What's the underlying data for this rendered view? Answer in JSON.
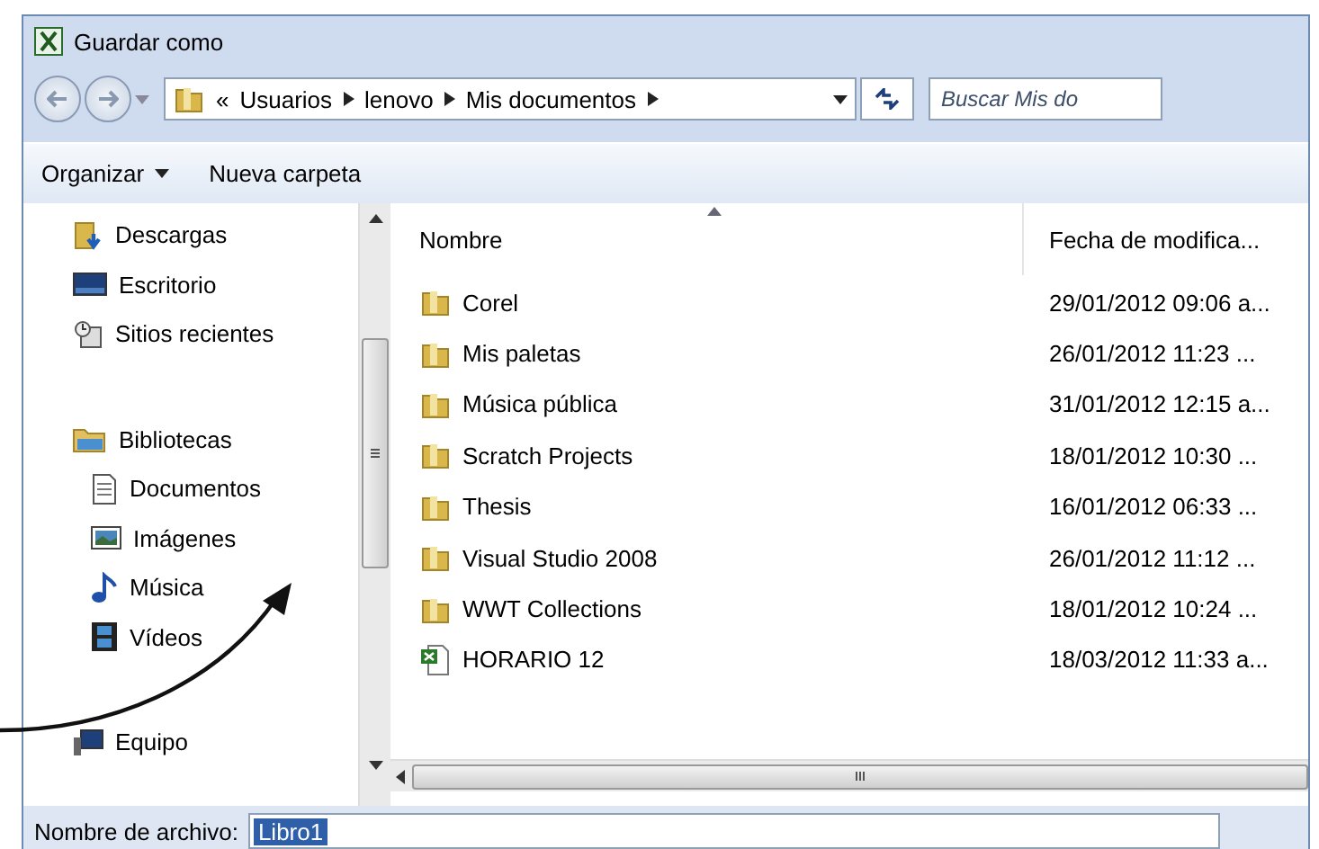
{
  "window": {
    "title": "Guardar como"
  },
  "address_bar": {
    "crumbs": [
      "«",
      "Usuarios",
      "lenovo",
      "Mis documentos"
    ],
    "search_placeholder": "Buscar Mis do"
  },
  "toolbar": {
    "buttons": [
      {
        "label": "Organizar",
        "dropdown": true
      },
      {
        "label": "Nueva carpeta",
        "dropdown": false
      }
    ]
  },
  "sidebar": {
    "groups": [
      {
        "items": [
          {
            "label": "Descargas"
          },
          {
            "label": "Escritorio"
          },
          {
            "label": "Sitios recientes"
          }
        ]
      },
      {
        "items": [
          {
            "label": "Bibliotecas",
            "children": [
              {
                "label": "Documentos"
              },
              {
                "label": "Imágenes"
              },
              {
                "label": "Música"
              },
              {
                "label": "Vídeos"
              }
            ]
          }
        ]
      },
      {
        "items": [
          {
            "label": "Equipo"
          }
        ]
      }
    ]
  },
  "table": {
    "columns": [
      {
        "label": "Nombre",
        "sorted": true
      },
      {
        "label": "Fecha de modifica...",
        "sorted": false
      }
    ],
    "rows": [
      {
        "kind": "folder",
        "name": "Corel",
        "date": "29/01/2012 09:06 a..."
      },
      {
        "kind": "folder",
        "name": "Mis paletas",
        "date": "26/01/2012 11:23 ..."
      },
      {
        "kind": "folder",
        "name": "Música pública",
        "date": "31/01/2012 12:15 a..."
      },
      {
        "kind": "folder",
        "name": "Scratch Projects",
        "date": "18/01/2012 10:30 ..."
      },
      {
        "kind": "folder",
        "name": "Thesis",
        "date": "16/01/2012 06:33 ..."
      },
      {
        "kind": "folder",
        "name": "Visual Studio 2008",
        "date": "26/01/2012 11:12 ..."
      },
      {
        "kind": "folder",
        "name": "WWT Collections",
        "date": "18/01/2012 10:24 ..."
      },
      {
        "kind": "spreadsheet",
        "name": "HORARIO 12",
        "date": "18/03/2012 11:33 a..."
      }
    ]
  },
  "filename": {
    "label": "Nombre de archivo:",
    "value": "Libro1",
    "value_selected": true
  }
}
